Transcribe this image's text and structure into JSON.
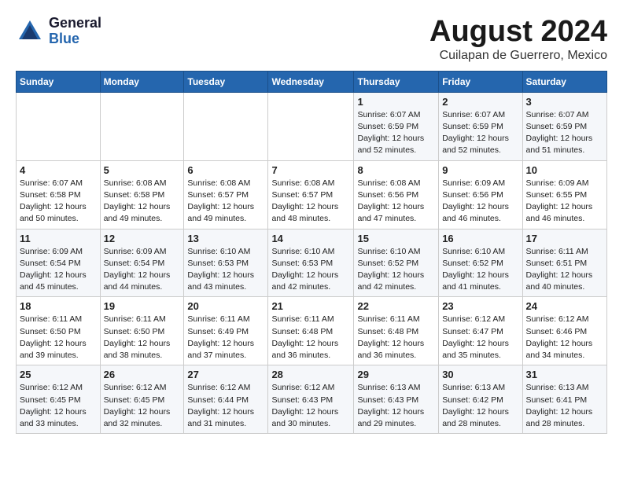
{
  "logo": {
    "text_top": "General",
    "text_bottom": "Blue"
  },
  "title": "August 2024",
  "subtitle": "Cuilapan de Guerrero, Mexico",
  "days_of_week": [
    "Sunday",
    "Monday",
    "Tuesday",
    "Wednesday",
    "Thursday",
    "Friday",
    "Saturday"
  ],
  "weeks": [
    [
      {
        "day": "",
        "info": ""
      },
      {
        "day": "",
        "info": ""
      },
      {
        "day": "",
        "info": ""
      },
      {
        "day": "",
        "info": ""
      },
      {
        "day": "1",
        "info": "Sunrise: 6:07 AM\nSunset: 6:59 PM\nDaylight: 12 hours\nand 52 minutes."
      },
      {
        "day": "2",
        "info": "Sunrise: 6:07 AM\nSunset: 6:59 PM\nDaylight: 12 hours\nand 52 minutes."
      },
      {
        "day": "3",
        "info": "Sunrise: 6:07 AM\nSunset: 6:59 PM\nDaylight: 12 hours\nand 51 minutes."
      }
    ],
    [
      {
        "day": "4",
        "info": "Sunrise: 6:07 AM\nSunset: 6:58 PM\nDaylight: 12 hours\nand 50 minutes."
      },
      {
        "day": "5",
        "info": "Sunrise: 6:08 AM\nSunset: 6:58 PM\nDaylight: 12 hours\nand 49 minutes."
      },
      {
        "day": "6",
        "info": "Sunrise: 6:08 AM\nSunset: 6:57 PM\nDaylight: 12 hours\nand 49 minutes."
      },
      {
        "day": "7",
        "info": "Sunrise: 6:08 AM\nSunset: 6:57 PM\nDaylight: 12 hours\nand 48 minutes."
      },
      {
        "day": "8",
        "info": "Sunrise: 6:08 AM\nSunset: 6:56 PM\nDaylight: 12 hours\nand 47 minutes."
      },
      {
        "day": "9",
        "info": "Sunrise: 6:09 AM\nSunset: 6:56 PM\nDaylight: 12 hours\nand 46 minutes."
      },
      {
        "day": "10",
        "info": "Sunrise: 6:09 AM\nSunset: 6:55 PM\nDaylight: 12 hours\nand 46 minutes."
      }
    ],
    [
      {
        "day": "11",
        "info": "Sunrise: 6:09 AM\nSunset: 6:54 PM\nDaylight: 12 hours\nand 45 minutes."
      },
      {
        "day": "12",
        "info": "Sunrise: 6:09 AM\nSunset: 6:54 PM\nDaylight: 12 hours\nand 44 minutes."
      },
      {
        "day": "13",
        "info": "Sunrise: 6:10 AM\nSunset: 6:53 PM\nDaylight: 12 hours\nand 43 minutes."
      },
      {
        "day": "14",
        "info": "Sunrise: 6:10 AM\nSunset: 6:53 PM\nDaylight: 12 hours\nand 42 minutes."
      },
      {
        "day": "15",
        "info": "Sunrise: 6:10 AM\nSunset: 6:52 PM\nDaylight: 12 hours\nand 42 minutes."
      },
      {
        "day": "16",
        "info": "Sunrise: 6:10 AM\nSunset: 6:52 PM\nDaylight: 12 hours\nand 41 minutes."
      },
      {
        "day": "17",
        "info": "Sunrise: 6:11 AM\nSunset: 6:51 PM\nDaylight: 12 hours\nand 40 minutes."
      }
    ],
    [
      {
        "day": "18",
        "info": "Sunrise: 6:11 AM\nSunset: 6:50 PM\nDaylight: 12 hours\nand 39 minutes."
      },
      {
        "day": "19",
        "info": "Sunrise: 6:11 AM\nSunset: 6:50 PM\nDaylight: 12 hours\nand 38 minutes."
      },
      {
        "day": "20",
        "info": "Sunrise: 6:11 AM\nSunset: 6:49 PM\nDaylight: 12 hours\nand 37 minutes."
      },
      {
        "day": "21",
        "info": "Sunrise: 6:11 AM\nSunset: 6:48 PM\nDaylight: 12 hours\nand 36 minutes."
      },
      {
        "day": "22",
        "info": "Sunrise: 6:11 AM\nSunset: 6:48 PM\nDaylight: 12 hours\nand 36 minutes."
      },
      {
        "day": "23",
        "info": "Sunrise: 6:12 AM\nSunset: 6:47 PM\nDaylight: 12 hours\nand 35 minutes."
      },
      {
        "day": "24",
        "info": "Sunrise: 6:12 AM\nSunset: 6:46 PM\nDaylight: 12 hours\nand 34 minutes."
      }
    ],
    [
      {
        "day": "25",
        "info": "Sunrise: 6:12 AM\nSunset: 6:45 PM\nDaylight: 12 hours\nand 33 minutes."
      },
      {
        "day": "26",
        "info": "Sunrise: 6:12 AM\nSunset: 6:45 PM\nDaylight: 12 hours\nand 32 minutes."
      },
      {
        "day": "27",
        "info": "Sunrise: 6:12 AM\nSunset: 6:44 PM\nDaylight: 12 hours\nand 31 minutes."
      },
      {
        "day": "28",
        "info": "Sunrise: 6:12 AM\nSunset: 6:43 PM\nDaylight: 12 hours\nand 30 minutes."
      },
      {
        "day": "29",
        "info": "Sunrise: 6:13 AM\nSunset: 6:43 PM\nDaylight: 12 hours\nand 29 minutes."
      },
      {
        "day": "30",
        "info": "Sunrise: 6:13 AM\nSunset: 6:42 PM\nDaylight: 12 hours\nand 28 minutes."
      },
      {
        "day": "31",
        "info": "Sunrise: 6:13 AM\nSunset: 6:41 PM\nDaylight: 12 hours\nand 28 minutes."
      }
    ]
  ]
}
